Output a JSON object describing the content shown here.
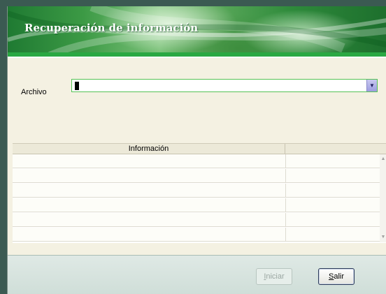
{
  "window": {
    "title": "Recuperación de información"
  },
  "form": {
    "archivo_label": "Archivo",
    "archivo_value": ""
  },
  "grid": {
    "columns": [
      "Información",
      ""
    ],
    "rows": [
      [
        "",
        ""
      ],
      [
        "",
        ""
      ],
      [
        "",
        ""
      ],
      [
        "",
        ""
      ],
      [
        "",
        ""
      ],
      [
        "",
        ""
      ]
    ]
  },
  "buttons": {
    "iniciar_label": "Iniciar",
    "iniciar_enabled": false,
    "salir_label": "Salir"
  },
  "colors": {
    "banner_green": "#2aa843",
    "combo_border": "#55c255"
  }
}
